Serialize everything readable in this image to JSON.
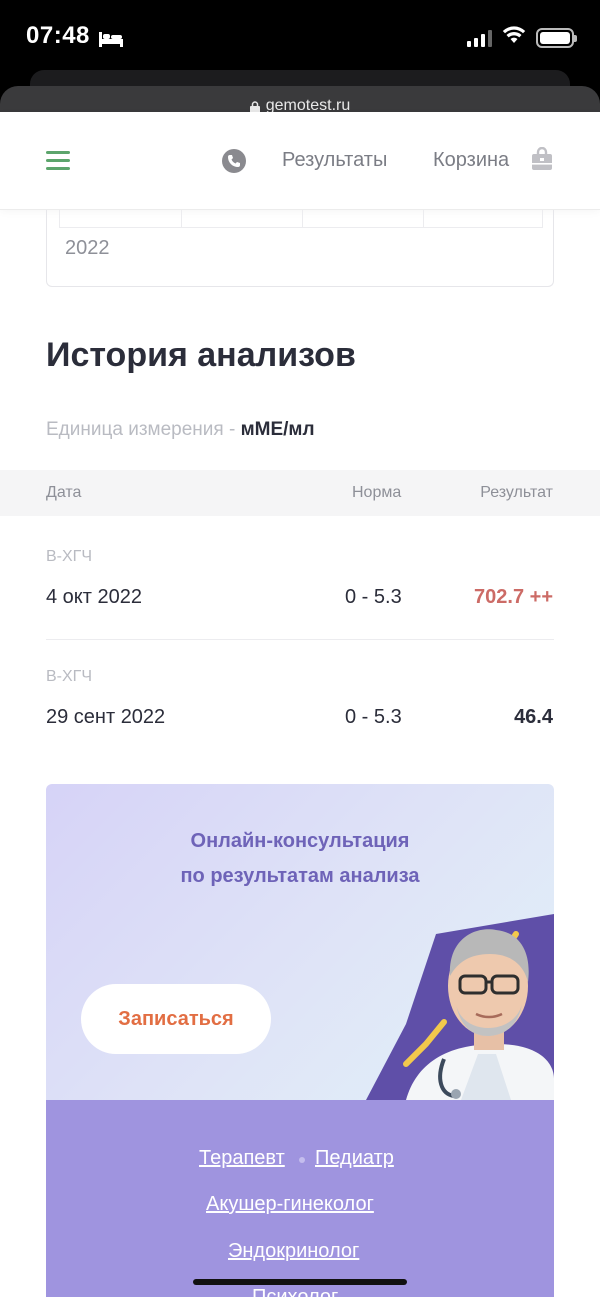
{
  "status_bar": {
    "time": "07:48",
    "icons": [
      "bed-icon",
      "signal-icon",
      "wifi-icon",
      "battery-icon"
    ]
  },
  "browser": {
    "url": "gemotest.ru",
    "lock_icon": "lock-icon"
  },
  "header": {
    "menu_icon": "burger-icon",
    "phone_icon": "phone-icon",
    "results_label": "Результаты",
    "cart_label": "Корзина",
    "cart_icon": "cart-icon",
    "accent_color": "#5ca56c"
  },
  "calendar": {
    "year": "2022"
  },
  "history": {
    "title": "История анализов",
    "units_label": "Единица измерения - ",
    "units_value": "мМЕ/мл",
    "columns": {
      "date": "Дата",
      "norm": "Норма",
      "result": "Результат"
    },
    "rows": [
      {
        "test": "В-ХГЧ",
        "date": "4 окт 2022",
        "norm": "0 - 5.3",
        "result": "702.7 ++",
        "flag": "high",
        "color": "#cc6b66"
      },
      {
        "test": "В-ХГЧ",
        "date": "29 сент 2022",
        "norm": "0 - 5.3",
        "result": "46.4",
        "flag": "normal",
        "color": "#2b2d3a"
      }
    ]
  },
  "promo": {
    "title_line1": "Онлайн-консультация",
    "title_line2": "по результатам анализа",
    "button_label": "Записаться",
    "links": {
      "therapist": "Терапевт",
      "pediatrician": "Педиатр",
      "gynecologist": "Акушер-гинеколог",
      "endocrinologist": "Эндокринолог",
      "psychologist": "Психолог"
    }
  }
}
